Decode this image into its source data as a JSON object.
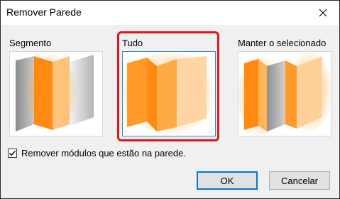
{
  "window": {
    "title": "Remover Parede",
    "close_icon": "close-icon"
  },
  "options": [
    {
      "label": "Segmento",
      "icon": "wall-segment-icon",
      "selected": false
    },
    {
      "label": "Tudo",
      "icon": "wall-all-icon",
      "selected": true
    },
    {
      "label": "Manter o selecionado",
      "icon": "wall-keep-selected-icon",
      "selected": false
    }
  ],
  "checkbox": {
    "label": "Remover módulos que estão na parede.",
    "checked": true
  },
  "buttons": {
    "ok": "OK",
    "cancel": "Cancelar"
  },
  "colors": {
    "highlight": "#e3141b",
    "selection_border": "#3a86c4",
    "wall_orange": "#ff8c1a",
    "default_button_border": "#0078d7"
  }
}
